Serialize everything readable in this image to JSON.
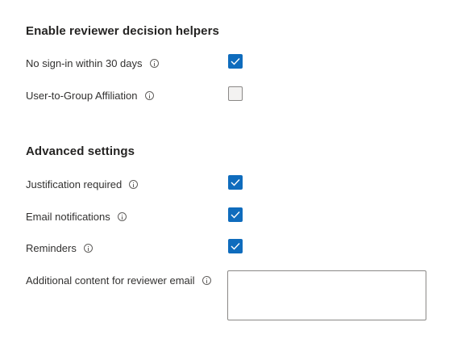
{
  "section_helpers": {
    "title": "Enable reviewer decision helpers",
    "items": [
      {
        "label": "No sign-in within 30 days",
        "checked": true
      },
      {
        "label": "User-to-Group Affiliation",
        "checked": false
      }
    ]
  },
  "section_advanced": {
    "title": "Advanced settings",
    "items": [
      {
        "label": "Justification required",
        "checked": true
      },
      {
        "label": "Email notifications",
        "checked": true
      },
      {
        "label": "Reminders",
        "checked": true
      }
    ],
    "additional_content": {
      "label": "Additional content for reviewer email",
      "value": ""
    }
  },
  "colors": {
    "accent": "#0f6cbd",
    "text": "#323130",
    "border": "#8a8886"
  }
}
